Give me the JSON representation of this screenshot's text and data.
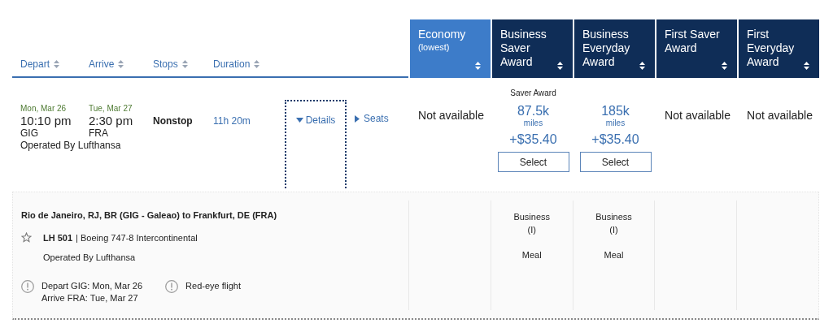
{
  "sort_columns": [
    {
      "label": "Depart"
    },
    {
      "label": "Arrive"
    },
    {
      "label": "Stops"
    },
    {
      "label": "Duration"
    }
  ],
  "fare_columns": [
    {
      "title": "Economy",
      "subtitle": "(lowest)",
      "selected": true
    },
    {
      "title": "Business Saver Award",
      "selected": false
    },
    {
      "title": "Business Everyday Award",
      "selected": false
    },
    {
      "title": "First Saver Award",
      "selected": false
    },
    {
      "title": "First Everyday Award",
      "selected": false
    }
  ],
  "flight": {
    "depart": {
      "date": "Mon, Mar 26",
      "time": "10:10 pm",
      "airport": "GIG"
    },
    "arrive": {
      "date": "Tue, Mar 27",
      "time": "2:30 pm",
      "airport": "FRA"
    },
    "operator": "Operated By Lufthansa",
    "stops": "Nonstop",
    "duration": "11h 20m",
    "details_link": "Details",
    "seats_link": "Seats",
    "fares": [
      {
        "kind": "unavailable",
        "text": "Not available"
      },
      {
        "kind": "award",
        "label": "Saver Award",
        "miles": "87.5k",
        "unit": "miles",
        "fee": "+$35.40",
        "button": "Select"
      },
      {
        "kind": "award",
        "miles": "185k",
        "unit": "miles",
        "fee": "+$35.40",
        "button": "Select"
      },
      {
        "kind": "unavailable",
        "text": "Not available"
      },
      {
        "kind": "unavailable",
        "text": "Not available"
      }
    ]
  },
  "details": {
    "route": "Rio de Janeiro, RJ, BR (GIG - Galeao) to Frankfurt, DE (FRA)",
    "flight_number": "LH 501",
    "aircraft": "| Boeing 747-8 Intercontinental",
    "operator": "Operated By Lufthansa",
    "notices": [
      {
        "lines": [
          "Depart GIG: Mon, Mar 26",
          "Arrive FRA: Tue, Mar 27"
        ]
      },
      {
        "lines": [
          "Red-eye flight"
        ]
      }
    ],
    "cabins": [
      {
        "kind": "empty"
      },
      {
        "kind": "cabin",
        "cabin": "Business",
        "code": "(I)",
        "meal": "Meal"
      },
      {
        "kind": "cabin",
        "cabin": "Business",
        "code": "(I)",
        "meal": "Meal"
      },
      {
        "kind": "empty"
      },
      {
        "kind": "empty"
      }
    ]
  }
}
